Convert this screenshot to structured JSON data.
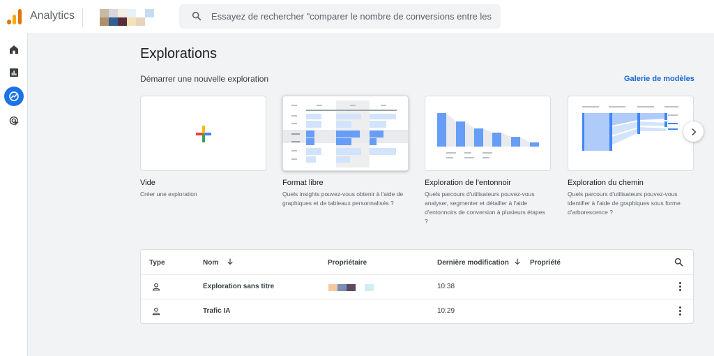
{
  "app": {
    "name": "Analytics"
  },
  "search": {
    "placeholder": "Essayez de rechercher \"comparer le nombre de conversions entre les rés..."
  },
  "colors": {
    "accent": "#1a73e8",
    "link": "#1967d2",
    "logo_dark": "#e37400",
    "logo_light": "#f9ab00"
  },
  "rail": {
    "items": [
      {
        "icon": "home-icon",
        "active": false
      },
      {
        "icon": "reports-icon",
        "active": false
      },
      {
        "icon": "explore-icon",
        "active": true
      },
      {
        "icon": "advertising-icon",
        "active": false
      }
    ]
  },
  "page": {
    "title": "Explorations",
    "section_title": "Démarrer une nouvelle exploration",
    "gallery_link": "Galerie de modèles"
  },
  "templates": [
    {
      "title": "Vide",
      "description": "Créer une exploration"
    },
    {
      "title": "Format libre",
      "description": "Quels insights pouvez-vous obtenir à l'aide de graphiques et de tableaux personnalisés ?"
    },
    {
      "title": "Exploration de l'entonnoir",
      "description": "Quels parcours d'utilisateurs pouvez-vous analyser, segmenter et détailler à l'aide d'entonnoirs de conversion à plusieurs étapes ?"
    },
    {
      "title": "Exploration du chemin",
      "description": "Quels parcours d'utilisateurs pouvez-vous identifier à l'aide de graphiques sous forme d'arborescence ?"
    }
  ],
  "table": {
    "columns": {
      "type": "Type",
      "name": "Nom",
      "owner": "Propriétaire",
      "modified": "Dernière modification",
      "property": "Propriété"
    },
    "rows": [
      {
        "type_icon": "person-icon",
        "name": "Exploration sans titre",
        "modified": "10:38"
      },
      {
        "type_icon": "person-icon",
        "name": "Trafic IA",
        "modified": "10:29"
      }
    ]
  }
}
